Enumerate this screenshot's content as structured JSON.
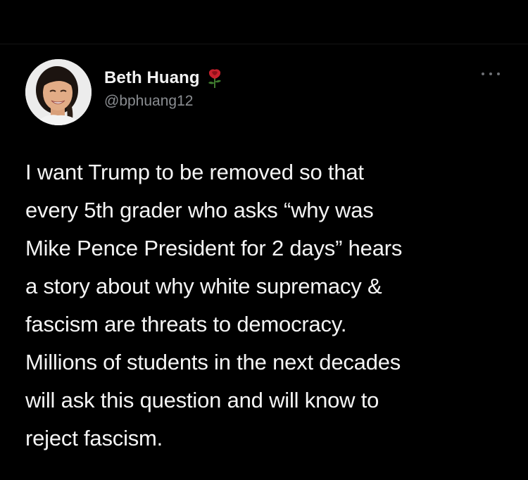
{
  "author": {
    "display_name": "Beth Huang",
    "handle": "@bphuang12",
    "name_emoji_icon": "rose-icon",
    "avatar_icon": "profile-photo"
  },
  "tweet": {
    "lines": [
      "I want Trump to be removed so that",
      "every 5th grader who asks “why was",
      "Mike Pence President for 2 days” hears",
      "a story about why white supremacy &",
      "fascism are threats to democracy.",
      "Millions of students in the next decades",
      "will ask this question and will know to",
      "reject fascism."
    ]
  },
  "menu": {
    "icon": "more-options-icon"
  },
  "colors": {
    "background": "#000000",
    "text": "#f4f4f4",
    "handle": "#8a8d91"
  }
}
